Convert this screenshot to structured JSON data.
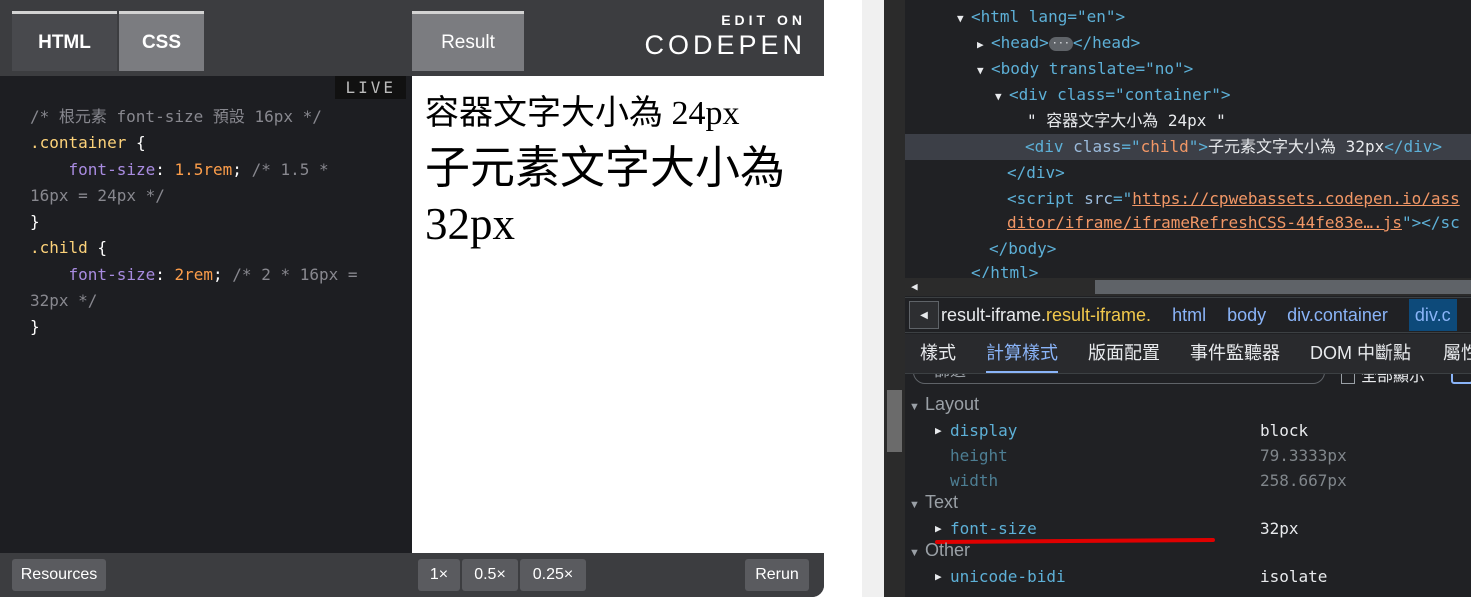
{
  "codepen": {
    "tabs": {
      "html": "HTML",
      "css": "CSS",
      "result": "Result"
    },
    "brand": {
      "edit_on": "EDIT ON",
      "name": "CODEPEN"
    },
    "live_badge": "LIVE",
    "css_code": {
      "line1": "/* 根元素 font-size 預設 16px */",
      "sel_container": ".container",
      "prop_font_size": "font-size",
      "val_15rem": "1.5rem",
      "comment_15": "/* 1.5 * 16px = 24px */",
      "sel_child": ".child",
      "val_2rem": "2rem",
      "comment_2": "/* 2 * 16px = 32px */"
    },
    "result": {
      "container_text": "容器文字大小為 24px",
      "child_text": "子元素文字大小為 32px"
    },
    "footer": {
      "resources": "Resources",
      "zoom_1x": "1×",
      "zoom_05x": "0.5×",
      "zoom_025x": "0.25×",
      "rerun": "Rerun"
    }
  },
  "devtools": {
    "dom": {
      "html_open": "<html lang=\"en\">",
      "head": "<head>",
      "head_close": "</head>",
      "body_open": "<body translate=\"no\">",
      "div_container": "<div class=\"container\">",
      "container_text": "\" 容器文字大小為 24px \"",
      "div_child_text": "子元素文字大小為 32px",
      "script_src_1": "https://cpwebassets.codepen.io/ass",
      "script_src_2": "ditor/iframe/iframeRefreshCSS-44fe83e….js",
      "body_close": "</body>",
      "html_close": "</html>"
    },
    "breadcrumb": {
      "first_prefix": "result-iframe.",
      "first_class": "result-iframe.",
      "items": [
        "html",
        "body",
        "div.container",
        "div.c"
      ]
    },
    "tabs": [
      "樣式",
      "計算樣式",
      "版面配置",
      "事件監聽器",
      "DOM 中斷點",
      "屬性"
    ],
    "active_tab": "計算樣式",
    "filter": {
      "placeholder": "篩選",
      "show_all": "全部顯示"
    },
    "sections": {
      "layout": "Layout",
      "text": "Text",
      "other": "Other"
    },
    "props": {
      "display": {
        "name": "display",
        "value": "block"
      },
      "height": {
        "name": "height",
        "value": "79.3333px"
      },
      "width": {
        "name": "width",
        "value": "258.667px"
      },
      "font_size": {
        "name": "font-size",
        "value": "32px"
      },
      "unicode_bidi": {
        "name": "unicode-bidi",
        "value": "isolate"
      }
    },
    "highlight_color": "#e00000"
  }
}
